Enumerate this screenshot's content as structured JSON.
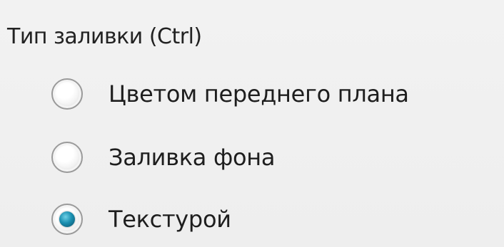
{
  "group": {
    "title": "Тип заливки (Ctrl)",
    "options": [
      {
        "label": "Цветом переднего плана",
        "selected": false
      },
      {
        "label": "Заливка фона",
        "selected": false
      },
      {
        "label": "Текстурой",
        "selected": true
      }
    ]
  },
  "colors": {
    "background": "#f0f0f0",
    "radio_selected_accent": "#1a8fb0"
  }
}
